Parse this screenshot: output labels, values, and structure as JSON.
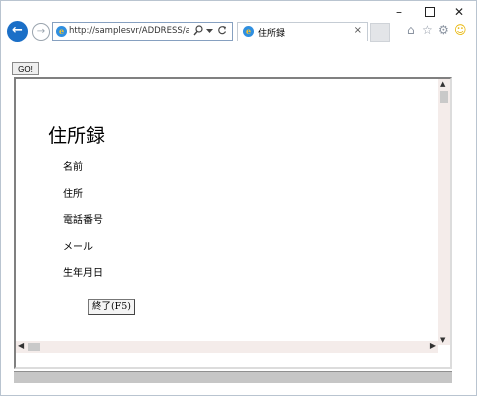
{
  "browser": {
    "url": "http://samplesvr/ADDRESS/address.ht",
    "search_icon": "search-icon",
    "dropdown_icon": "chevron-down-icon",
    "refresh_icon": "refresh-icon",
    "tab_title": "住所録",
    "tab_close": "×",
    "back_glyph": "←",
    "forward_glyph": "→",
    "window_min": "–",
    "window_close": "✕",
    "home_glyph": "⌂",
    "star_glyph": "☆",
    "gear_glyph": "⚙",
    "smiley_glyph": "☺",
    "accent_color": "#1b6fc7"
  },
  "page": {
    "go_button": "GO!",
    "title": "住所録",
    "fields": [
      "名前",
      "住所",
      "電話番号",
      "メール",
      "生年月日"
    ],
    "end_button": "終了(F5)"
  }
}
